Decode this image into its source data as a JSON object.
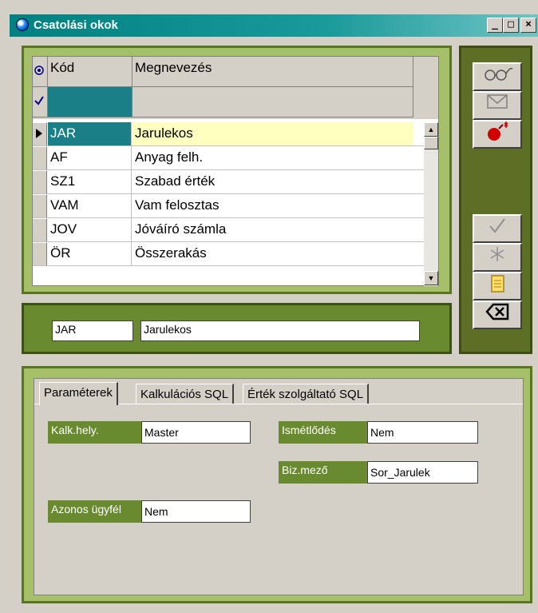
{
  "window": {
    "title": "Csatolási okok",
    "min": "_",
    "max": "□",
    "close": "×"
  },
  "grid": {
    "columns": [
      "Kód",
      "Megnevezés"
    ],
    "rows": [
      {
        "code": "JAR",
        "name": "Jarulekos"
      },
      {
        "code": "AF",
        "name": "Anyag felh."
      },
      {
        "code": "SZ1",
        "name": "Szabad érték"
      },
      {
        "code": "VAM",
        "name": "Vam felosztas"
      },
      {
        "code": "JOV",
        "name": "Jóváíró számla"
      },
      {
        "code": "ÖR",
        "name": "Összerakás"
      }
    ]
  },
  "edit": {
    "code": "JAR",
    "name": "Jarulekos"
  },
  "tabs": [
    "Paraméterek",
    "Kalkulációs SQL",
    "Érték szolgáltató SQL"
  ],
  "params": {
    "kalk_label": "Kalk.hely.",
    "kalk_value": "Master",
    "ism_label": "Ismétlődés",
    "ism_value": "Nem",
    "biz_label": "Biz.mező",
    "biz_value": "Sor_Jarulek",
    "azon_label": "Azonos ügyfél",
    "azon_value": "Nem"
  },
  "colors": {
    "green_dark": "#698a2e",
    "green_light": "#a6c06a",
    "teal": "#1a7f86",
    "highlight": "#ffffc0"
  }
}
